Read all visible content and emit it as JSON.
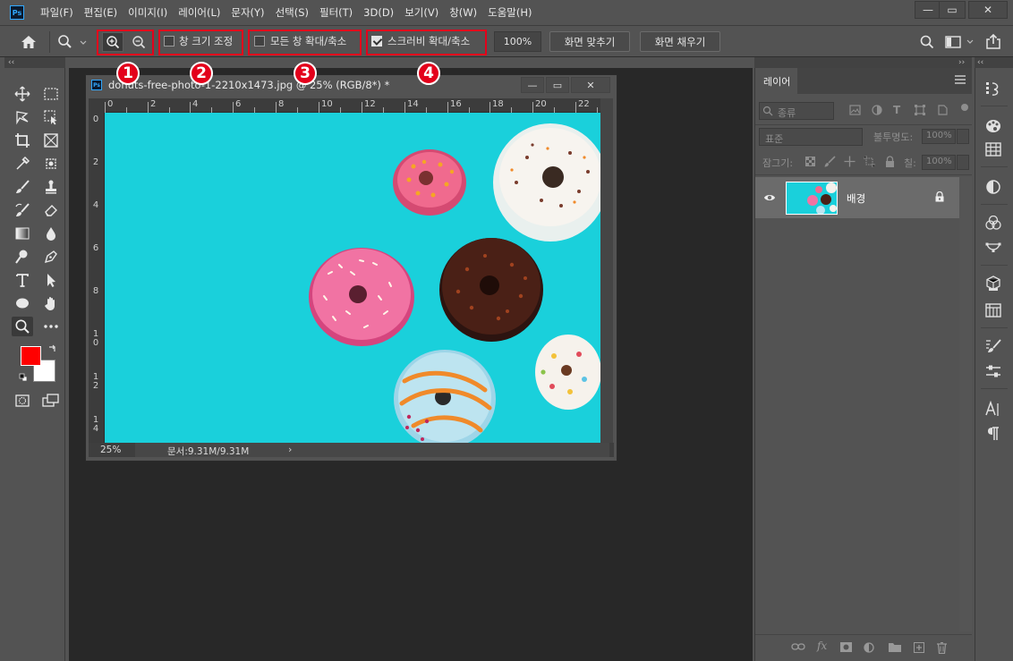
{
  "app": {
    "logo_text": "Ps",
    "menu": [
      "파일(F)",
      "편집(E)",
      "이미지(I)",
      "레이어(L)",
      "문자(Y)",
      "선택(S)",
      "필터(T)",
      "3D(D)",
      "보기(V)",
      "창(W)",
      "도움말(H)"
    ],
    "window_controls": [
      "—",
      "▭",
      "✕"
    ]
  },
  "options": {
    "resize_windows_label": "창 크기 조정",
    "resize_windows_checked": false,
    "zoom_all_windows_label": "모든 창 확대/축소",
    "zoom_all_windows_checked": false,
    "scrubby_zoom_label": "스크러비 확대/축소",
    "scrubby_zoom_checked": true,
    "zoom_value": "100%",
    "fit_screen_label": "화면 맞추기",
    "fill_screen_label": "화면 채우기",
    "annotations": [
      "1",
      "2",
      "3",
      "4"
    ],
    "highlight_color": "#e3001b"
  },
  "panel_collapse": {
    "left": "‹‹",
    "right": "››"
  },
  "tools": {
    "foreground_color": "#ff0000",
    "background_color": "#ffffff"
  },
  "document": {
    "title": "donuts-free-photo-1-2210x1473.jpg @ 25% (RGB/8*) *",
    "ruler_h": [
      "0",
      "2",
      "4",
      "6",
      "8",
      "10",
      "12",
      "14",
      "16",
      "18",
      "20",
      "22"
    ],
    "ruler_v": [
      "0",
      "2",
      "4",
      "6",
      "8",
      "10",
      "12",
      "14"
    ],
    "status_zoom": "25%",
    "status_doc": "문서:9.31M/9.31M",
    "status_arrow": "›",
    "canvas_color": "#1ad0db"
  },
  "layers": {
    "tab_label": "레이어",
    "filter_label": "종류",
    "blend_mode": "표준",
    "opacity_label": "불투명도:",
    "opacity_value": "100%",
    "lock_label": "잠그기:",
    "fill_label": "칠:",
    "fill_value": "100%",
    "items": [
      {
        "name": "배경",
        "visible": true,
        "locked": true
      }
    ],
    "bottom_icons": [
      "link-icon",
      "fx-icon",
      "mask-icon",
      "adjustment-icon",
      "group-icon",
      "new-layer-icon",
      "trash-icon"
    ]
  }
}
